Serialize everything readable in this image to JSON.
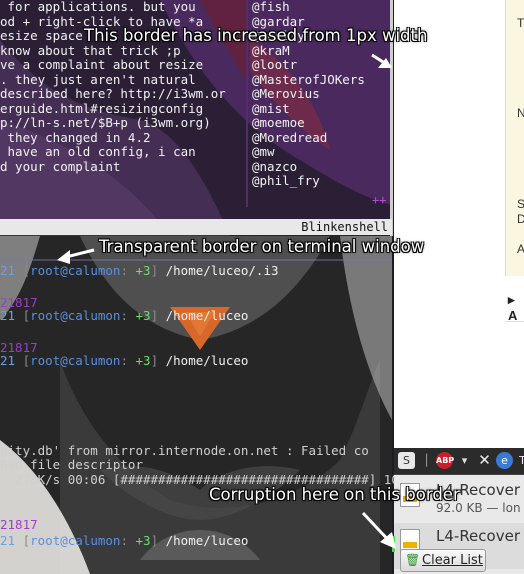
{
  "chat": {
    "lines": [
      " for applications. but you",
      "od + right-click to have *a",
      "esize space",
      "know about that trick ;p",
      "ve a complaint about resize",
      ". they just aren't natural",
      "described here? http://i3wm.or",
      "erguide.html#resizingconfig",
      "p://ln-s.net/$B+p (i3wm.org)",
      " they changed in 4.2",
      " have an old config, i can",
      "d your complaint"
    ],
    "nicks": [
      "@fish",
      "@gardar",
      "@koolfy",
      "@kraM",
      "@lootr",
      "@MasterofJOKers",
      "@Merovius",
      "@mist",
      "@moemoe",
      "@Moredread",
      "@mw",
      "@nazco",
      "@phil_fry"
    ],
    "nick_more": "++",
    "status_title": "Blinkenshell"
  },
  "terminal": {
    "num_partial": "21",
    "user_host": "root@calumon",
    "plus_count": "+3",
    "prompt_1_path": "/home/luceo/.i3",
    "prompt_2_path": "/home/luceo",
    "prompt_3_path": "/home/luceo",
    "prompt_4_path": "/home/luceo",
    "pid_marker": "21817",
    "err_line_1": "pity.db' from mirror.internode.on.net : Failed co",
    "err_line_2": "Bad file descriptor",
    "progress_line": "  273K/s 00:06 [#################################] 100%"
  },
  "right_panel": {
    "letters": [
      "T",
      "N",
      "S",
      "D",
      "A"
    ],
    "bullet": "▸ A"
  },
  "downloads": {
    "items": [
      {
        "name": "L4-Recover",
        "meta": "92.0 KB — lon"
      },
      {
        "name": "L4-Recover",
        "meta": ""
      }
    ],
    "clear_label": "Clear List"
  },
  "toolbar_icons": [
    "s-icon",
    "abp-icon",
    "dropdown-icon",
    "close-x-icon",
    "browser-icon",
    "t-label"
  ],
  "annotations": {
    "border_width": "This border has increased from 1px width",
    "transparent_border": "Transparent border on terminal window",
    "corruption": "Corruption here on this border"
  },
  "colors": {
    "accent_purple": "#9b3fc4",
    "term_green": "#6fdc6f",
    "term_blue": "#5a8fe0",
    "corruption_green": "#44dd44"
  }
}
